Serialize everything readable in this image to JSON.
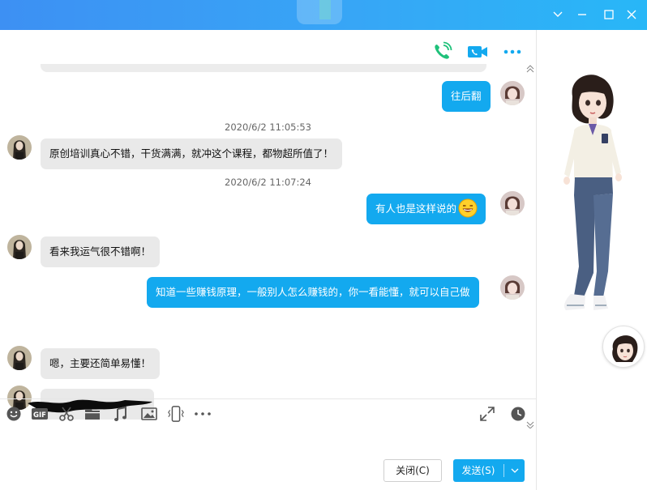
{
  "window": {
    "controls": {
      "collapse_icon": "chevron-down-icon",
      "minimize_icon": "minimize-icon",
      "maximize_icon": "maximize-icon",
      "close_icon": "close-icon"
    },
    "accent": "#13a9ef"
  },
  "header_actions": {
    "voice_call_icon": "phone-icon",
    "video_call_icon": "video-icon",
    "more_icon": "more-icon"
  },
  "messages": [
    {
      "id": "m1",
      "direction": "out",
      "text": "往后翻"
    },
    {
      "id": "t1",
      "type": "timestamp",
      "text": "2020/6/2 11:05:53"
    },
    {
      "id": "m2",
      "direction": "in",
      "text": "原创培训真心不错，干货满满，就冲这个课程，都物超所值了！"
    },
    {
      "id": "t2",
      "type": "timestamp",
      "text": "2020/6/2 11:07:24"
    },
    {
      "id": "m3",
      "direction": "out",
      "text": "有人也是这样说的"
    },
    {
      "id": "m4",
      "direction": "in",
      "text": "看来我运气很不错啊！"
    },
    {
      "id": "m5",
      "direction": "out",
      "text": "知道一些赚钱原理，一般别人怎么赚钱的，你一看能懂，就可以自己做"
    },
    {
      "id": "m6",
      "direction": "in",
      "text": "嗯，主要还简单易懂！"
    },
    {
      "id": "m7",
      "direction": "in",
      "text": ""
    }
  ],
  "toolbar": {
    "icons": [
      "emoji-icon",
      "gif-icon",
      "scissors-icon",
      "folder-icon",
      "music-icon",
      "image-icon",
      "shake-icon",
      "more-icon"
    ],
    "right_icons": [
      "expand-icon",
      "history-icon"
    ]
  },
  "input": {
    "value": ""
  },
  "buttons": {
    "close": "关闭(C)",
    "send": "发送(S)"
  }
}
